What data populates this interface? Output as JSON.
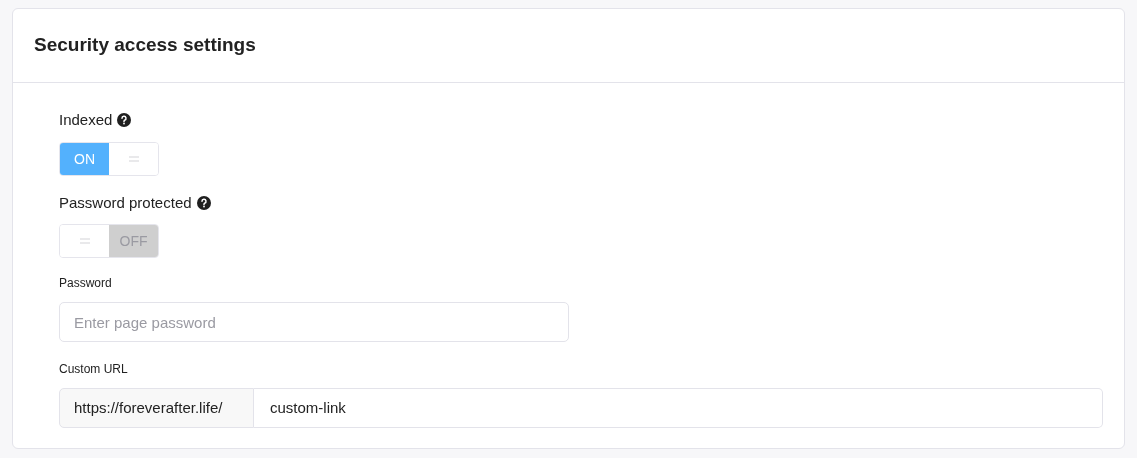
{
  "card": {
    "title": "Security access settings"
  },
  "toggles": [
    {
      "label": "Indexed",
      "on": true,
      "state_text": "ON"
    },
    {
      "label": "Password protected",
      "on": false,
      "state_text": "OFF"
    }
  ],
  "password": {
    "label": "Password",
    "placeholder": "Enter page password"
  },
  "custom_url": {
    "label": "Custom URL",
    "prefix": "https://foreverafter.life/",
    "value": "custom-link"
  }
}
